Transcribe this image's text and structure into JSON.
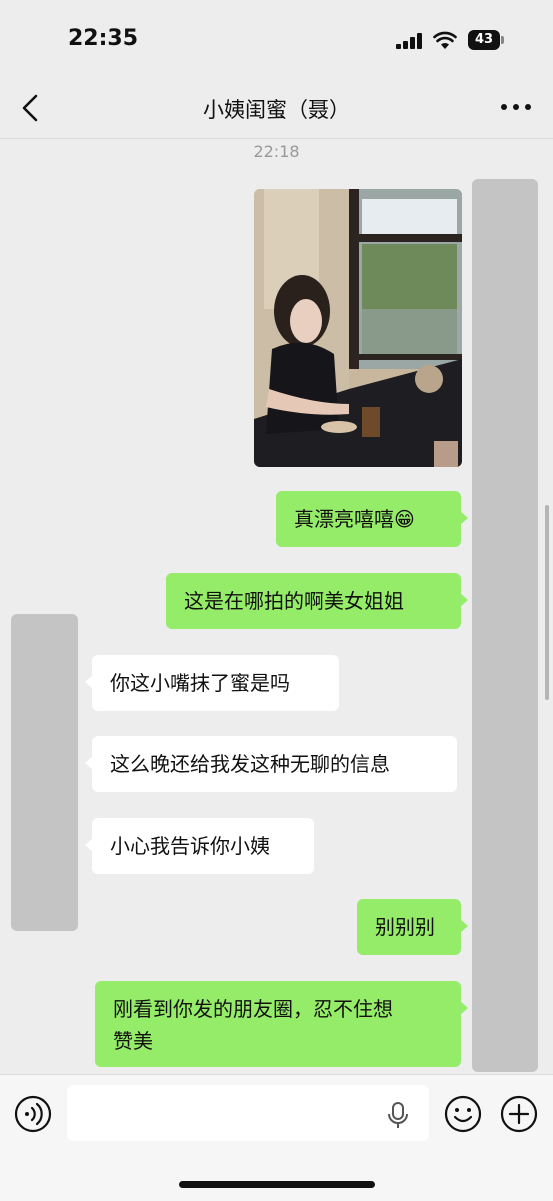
{
  "status_bar": {
    "time": "22:35",
    "battery": "43"
  },
  "header": {
    "title": "小姨闺蜜（聂）"
  },
  "chat": {
    "timestamp": "22:18",
    "messages": [
      {
        "side": "right",
        "type": "image",
        "description": "photo"
      },
      {
        "side": "right",
        "text": "真漂亮嘻嘻😁"
      },
      {
        "side": "right",
        "text": "这是在哪拍的啊美女姐姐"
      },
      {
        "side": "left",
        "text": "你这小嘴抹了蜜是吗"
      },
      {
        "side": "left",
        "text": "这么晚还给我发这种无聊的信息"
      },
      {
        "side": "left",
        "text": "小心我告诉你小姨"
      },
      {
        "side": "right",
        "text": "别别别"
      },
      {
        "side": "right",
        "text_line1": "刚看到你发的朋友圈，忍不住想",
        "text_line2": "赞美"
      }
    ]
  },
  "input_bar": {
    "placeholder": ""
  },
  "colors": {
    "outgoing_bubble": "#95ec69",
    "incoming_bubble": "#ffffff",
    "background": "#ededed"
  }
}
